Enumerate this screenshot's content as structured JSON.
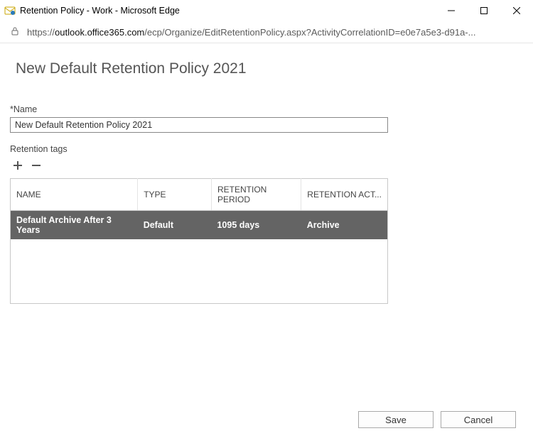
{
  "window": {
    "title": "Retention Policy - Work - Microsoft Edge"
  },
  "address": {
    "scheme": "https://",
    "host": "outlook.office365.com",
    "path": "/ecp/Organize/EditRetentionPolicy.aspx?ActivityCorrelationID=e0e7a5e3-d91a-..."
  },
  "page": {
    "title": "New Default Retention Policy 2021",
    "name_label": "*Name",
    "name_value": "New Default Retention Policy 2021",
    "tags_label": "Retention tags"
  },
  "grid": {
    "columns": {
      "name": "NAME",
      "type": "TYPE",
      "period": "RETENTION PERIOD",
      "action": "RETENTION ACT..."
    },
    "rows": [
      {
        "name": "Default Archive After 3 Years",
        "type": "Default",
        "period": "1095 days",
        "action": "Archive"
      }
    ]
  },
  "buttons": {
    "save": "Save",
    "cancel": "Cancel"
  }
}
